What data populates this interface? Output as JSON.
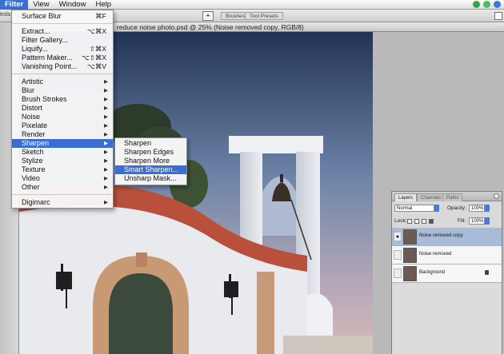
{
  "menubar": {
    "items": [
      "Filter",
      "View",
      "Window",
      "Help"
    ],
    "active": "Filter"
  },
  "optionsbar": {
    "left_label": "trols",
    "workspace_tabs": [
      "Brushes",
      "Tool Presets"
    ]
  },
  "document": {
    "title": "reduce noise photo.psd @ 25% (Noise removed copy, RGB/8)"
  },
  "filter_menu": {
    "last_filter": {
      "label": "Surface Blur",
      "shortcut": "⌘F"
    },
    "group1": [
      {
        "label": "Extract...",
        "shortcut": "⌥⌘X"
      },
      {
        "label": "Filter Gallery...",
        "shortcut": ""
      },
      {
        "label": "Liquify...",
        "shortcut": "⇧⌘X"
      },
      {
        "label": "Pattern Maker...",
        "shortcut": "⌥⇧⌘X"
      },
      {
        "label": "Vanishing Point...",
        "shortcut": "⌥⌘V"
      }
    ],
    "submenus": [
      "Artistic",
      "Blur",
      "Brush Strokes",
      "Distort",
      "Noise",
      "Pixelate",
      "Render",
      "Sharpen",
      "Sketch",
      "Stylize",
      "Texture",
      "Video",
      "Other"
    ],
    "highlighted": "Sharpen",
    "extra": "Digimarc",
    "submenu_arrow": "▶"
  },
  "sharpen_submenu": {
    "items": [
      "Sharpen",
      "Sharpen Edges",
      "Sharpen More",
      "Smart Sharpen...",
      "Unsharp Mask..."
    ],
    "highlighted": "Smart Sharpen..."
  },
  "layers_panel": {
    "tabs": [
      "Layers",
      "Channels",
      "Paths"
    ],
    "blend_mode": "Normal",
    "opacity_label": "Opacity:",
    "opacity_value": "100%",
    "lock_label": "Lock:",
    "fill_label": "Fill:",
    "fill_value": "100%",
    "layers": [
      {
        "name": "Noise removed copy",
        "visible": true,
        "selected": true
      },
      {
        "name": "Noise removed",
        "visible": false,
        "selected": false
      },
      {
        "name": "Background",
        "visible": false,
        "selected": false,
        "locked": true
      }
    ]
  },
  "colors": {
    "menu_highlight": "#3a6fd1",
    "layer_selected": "#a8bcd9",
    "roof_tile": "#b8503b",
    "stone_arch": "#c89a74"
  }
}
